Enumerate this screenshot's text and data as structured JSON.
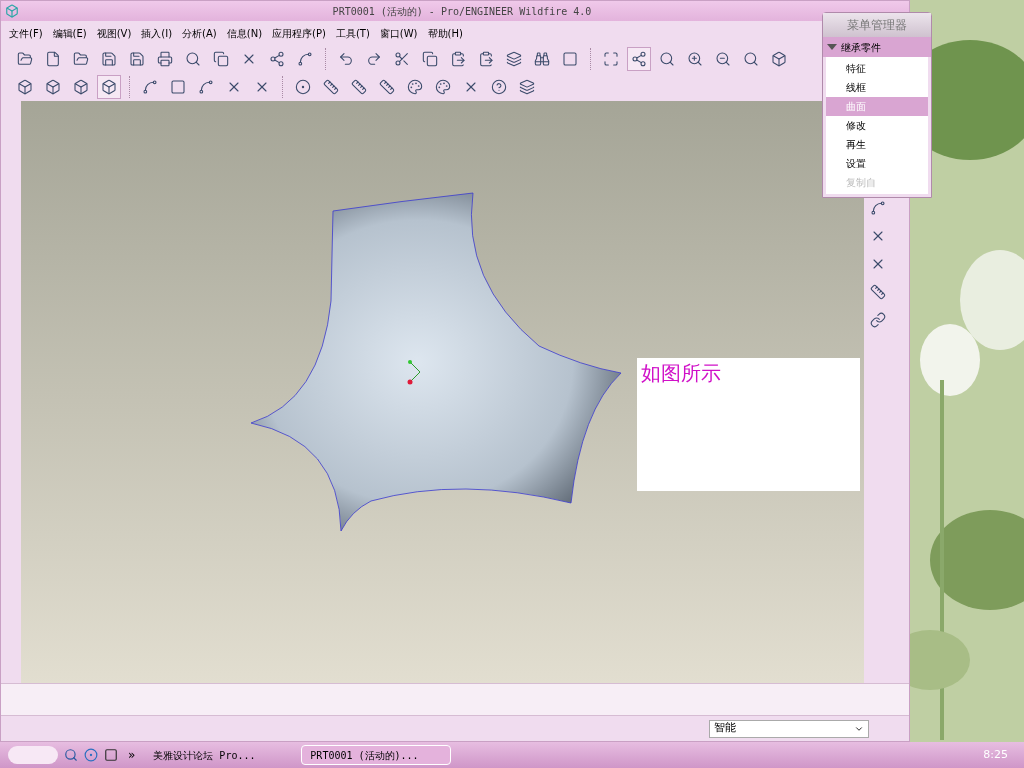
{
  "window": {
    "title": "PRT0001 (活动的) - Pro/ENGINEER Wildfire 4.0"
  },
  "menu_bar": [
    "文件(F)",
    "编辑(E)",
    "视图(V)",
    "插入(I)",
    "分析(A)",
    "信息(N)",
    "应用程序(P)",
    "工具(T)",
    "窗口(W)",
    "帮助(H)"
  ],
  "menu_manager": {
    "title": "菜单管理器",
    "section": {
      "label": "继承零件",
      "expanded": true
    },
    "items": [
      {
        "label": "特征",
        "selected": false,
        "disabled": false
      },
      {
        "label": "线框",
        "selected": false,
        "disabled": false
      },
      {
        "label": "曲面",
        "selected": true,
        "disabled": false
      },
      {
        "label": "修改",
        "selected": false,
        "disabled": false
      },
      {
        "label": "再生",
        "selected": false,
        "disabled": false
      },
      {
        "label": "设置",
        "selected": false,
        "disabled": false
      },
      {
        "label": "复制自",
        "selected": false,
        "disabled": true
      }
    ]
  },
  "note": "如图所示",
  "status_bar": {
    "filter": "智能"
  },
  "taskbar": {
    "items": [
      {
        "label": "美雅设计论坛 Pro...",
        "selected": false
      },
      {
        "label": "PRT0001 (活动的)...",
        "selected": true
      }
    ],
    "overflow": "»",
    "clock": "8:25"
  }
}
